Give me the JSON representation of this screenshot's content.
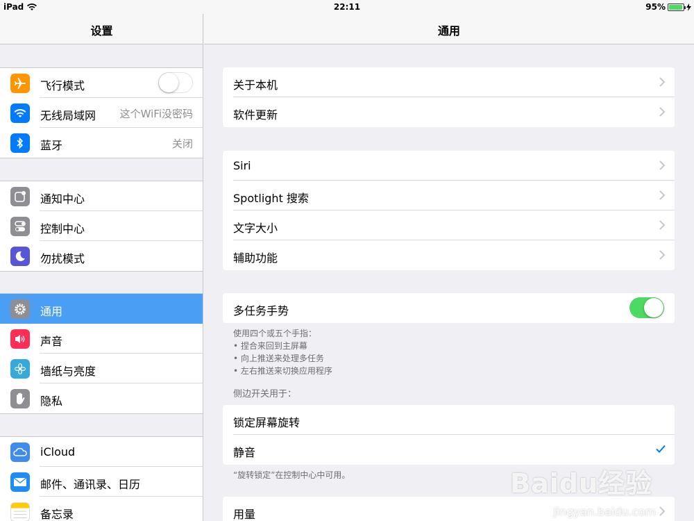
{
  "status_bar": {
    "device": "iPad",
    "time": "22:11",
    "battery": "95%",
    "battery_level": 0.95
  },
  "sidebar": {
    "title": "设置",
    "groups": [
      [
        {
          "label": "飞行模式",
          "icon": "airplane-icon",
          "color": "#ff9500",
          "toggle": false
        },
        {
          "label": "无线局域网",
          "icon": "wifi-icon",
          "color": "#007aff",
          "value": "这个WiFi没密码"
        },
        {
          "label": "蓝牙",
          "icon": "bluetooth-icon",
          "color": "#007aff",
          "value": "关闭"
        }
      ],
      [
        {
          "label": "通知中心",
          "icon": "notification-center-icon",
          "color": "#8e8e93"
        },
        {
          "label": "控制中心",
          "icon": "control-center-icon",
          "color": "#8e8e93"
        },
        {
          "label": "勿扰模式",
          "icon": "moon-icon",
          "color": "#5856d6"
        }
      ],
      [
        {
          "label": "通用",
          "icon": "gear-icon",
          "color": "#8e8e93",
          "selected": true
        },
        {
          "label": "声音",
          "icon": "speaker-icon",
          "color": "#ff2d55"
        },
        {
          "label": "墙纸与亮度",
          "icon": "flower-icon",
          "color": "#34aadc"
        },
        {
          "label": "隐私",
          "icon": "hand-icon",
          "color": "#8e8e93"
        }
      ],
      [
        {
          "label": "iCloud",
          "icon": "cloud-icon",
          "color": "#3f8cf0"
        },
        {
          "label": "邮件、通讯录、日历",
          "icon": "mail-icon",
          "color": "#1d8df5"
        },
        {
          "label": "备忘录",
          "icon": "notes-icon",
          "color": "#ffcc00"
        }
      ]
    ]
  },
  "main": {
    "title": "通用",
    "group1": [
      "关于本机",
      "软件更新"
    ],
    "group2": [
      "Siri",
      "Spotlight 搜索",
      "文字大小",
      "辅助功能"
    ],
    "multitask": {
      "label": "多任务手势",
      "toggle": true
    },
    "multitask_footer": [
      "使用四个或五个手指：",
      "• 捏合来回到主屏幕",
      "• 向上推送来处理多任务",
      "• 左右推送来切换应用程序"
    ],
    "side_switch_header": "侧边开关用于：",
    "side_switch_options": [
      {
        "label": "锁定屏幕旋转",
        "checked": false
      },
      {
        "label": "静音",
        "checked": true
      }
    ],
    "side_switch_footer": "“旋转锁定”在控制中心中可用。",
    "usage": "用量"
  },
  "watermark": {
    "logo": "Baidu经验",
    "url": "jingyan.baidu.com"
  }
}
